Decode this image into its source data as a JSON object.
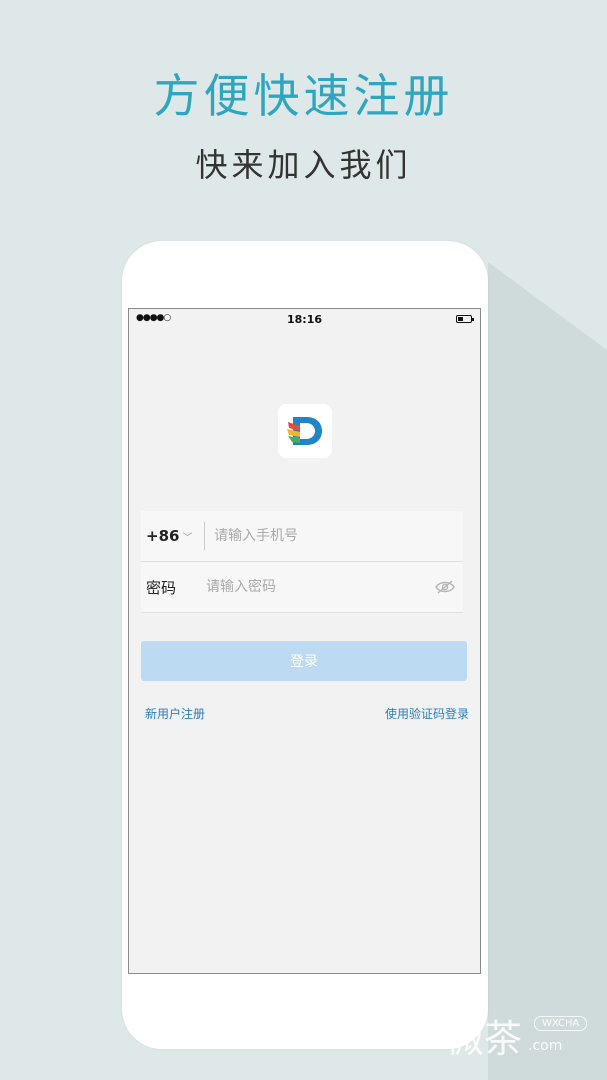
{
  "promo": {
    "headline": "方便快速注册",
    "subhead": "快来加入我们"
  },
  "status_bar": {
    "signal": "●●●●○",
    "time": "18:16",
    "battery_level": 0.45
  },
  "app": {
    "logo_icon": "app-logo-d-icon",
    "accent_color": "#2fa6c0",
    "button_color": "#bcdaf2",
    "link_color": "#2a7fbf"
  },
  "login_form": {
    "country_code": "+86",
    "phone_placeholder": "请输入手机号",
    "password_label": "密码",
    "password_placeholder": "请输入密码",
    "login_button": "登录",
    "register_link": "新用户注册",
    "sms_login_link": "使用验证码登录"
  },
  "watermark": {
    "chinese": "微茶",
    "tag": "WXCHA",
    "url": ".com"
  }
}
